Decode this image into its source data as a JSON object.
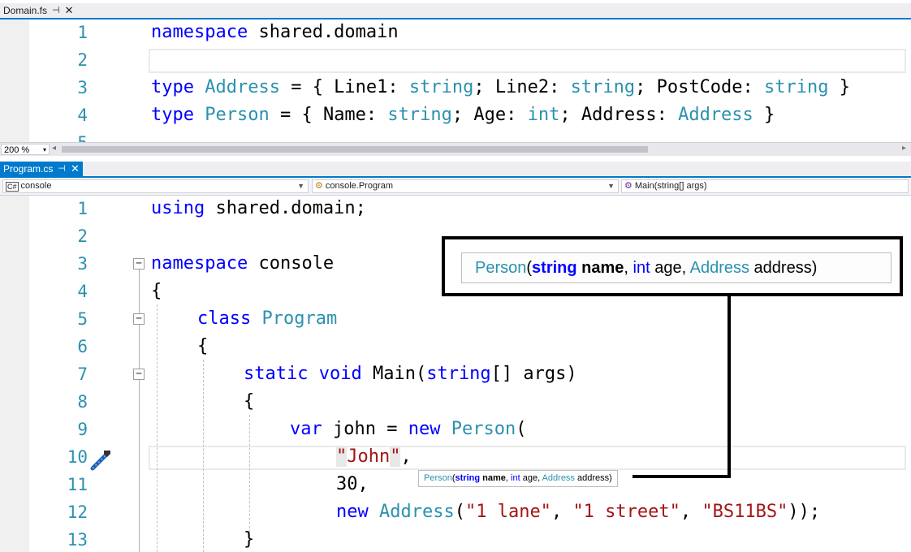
{
  "domain_pane": {
    "tab": {
      "label": "Domain.fs",
      "pin": "⊣",
      "close": "✕"
    },
    "lines": [
      {
        "n": "1",
        "tokens": [
          {
            "t": "namespace",
            "c": "kw"
          },
          {
            "t": " shared.domain",
            "c": ""
          }
        ]
      },
      {
        "n": "2",
        "tokens": []
      },
      {
        "n": "3",
        "tokens": [
          {
            "t": "type",
            "c": "kw"
          },
          {
            "t": " ",
            "c": ""
          },
          {
            "t": "Address",
            "c": "ty"
          },
          {
            "t": " = { Line1: ",
            "c": ""
          },
          {
            "t": "string",
            "c": "ty"
          },
          {
            "t": "; Line2: ",
            "c": ""
          },
          {
            "t": "string",
            "c": "ty"
          },
          {
            "t": "; PostCode: ",
            "c": ""
          },
          {
            "t": "string",
            "c": "ty"
          },
          {
            "t": " }",
            "c": ""
          }
        ]
      },
      {
        "n": "4",
        "tokens": [
          {
            "t": "type",
            "c": "kw"
          },
          {
            "t": " ",
            "c": ""
          },
          {
            "t": "Person",
            "c": "ty"
          },
          {
            "t": " = { Name: ",
            "c": ""
          },
          {
            "t": "string",
            "c": "ty"
          },
          {
            "t": "; Age: ",
            "c": ""
          },
          {
            "t": "int",
            "c": "ty"
          },
          {
            "t": "; Address: ",
            "c": ""
          },
          {
            "t": "Address",
            "c": "ty"
          },
          {
            "t": " }",
            "c": ""
          }
        ]
      }
    ],
    "zoom": "200 %"
  },
  "program_pane": {
    "tab": {
      "label": "Program.cs",
      "pin": "⊣",
      "close": "✕"
    },
    "nav": {
      "project": "console",
      "type": "console.Program",
      "member": "Main(string[] args)"
    },
    "lines": [
      {
        "n": "1",
        "indent": 0,
        "tokens": [
          {
            "t": "using",
            "c": "kw"
          },
          {
            "t": " shared.domain;",
            "c": ""
          }
        ]
      },
      {
        "n": "2",
        "indent": 0,
        "tokens": []
      },
      {
        "n": "3",
        "indent": 0,
        "tokens": [
          {
            "t": "namespace",
            "c": "kw"
          },
          {
            "t": " console",
            "c": ""
          }
        ]
      },
      {
        "n": "4",
        "indent": 0,
        "tokens": [
          {
            "t": "{",
            "c": ""
          }
        ]
      },
      {
        "n": "5",
        "indent": 1,
        "tokens": [
          {
            "t": "class",
            "c": "kw"
          },
          {
            "t": " ",
            "c": ""
          },
          {
            "t": "Program",
            "c": "ty"
          }
        ]
      },
      {
        "n": "6",
        "indent": 1,
        "tokens": [
          {
            "t": "{",
            "c": ""
          }
        ]
      },
      {
        "n": "7",
        "indent": 2,
        "tokens": [
          {
            "t": "static",
            "c": "kw"
          },
          {
            "t": " ",
            "c": ""
          },
          {
            "t": "void",
            "c": "kw"
          },
          {
            "t": " Main(",
            "c": ""
          },
          {
            "t": "string",
            "c": "kw"
          },
          {
            "t": "[] args)",
            "c": ""
          }
        ]
      },
      {
        "n": "8",
        "indent": 2,
        "tokens": [
          {
            "t": "{",
            "c": ""
          }
        ]
      },
      {
        "n": "9",
        "indent": 3,
        "tokens": [
          {
            "t": "var",
            "c": "kw"
          },
          {
            "t": " john = ",
            "c": ""
          },
          {
            "t": "new",
            "c": "kw"
          },
          {
            "t": " ",
            "c": ""
          },
          {
            "t": "Person",
            "c": "ty"
          },
          {
            "t": "(",
            "c": ""
          }
        ]
      },
      {
        "n": "10",
        "indent": 4,
        "tokens": [
          {
            "t": "\"",
            "c": "str hl"
          },
          {
            "t": "John",
            "c": "str"
          },
          {
            "t": "\"",
            "c": "str hl"
          },
          {
            "t": ",",
            "c": ""
          }
        ]
      },
      {
        "n": "11",
        "indent": 4,
        "tokens": [
          {
            "t": "30,",
            "c": ""
          }
        ]
      },
      {
        "n": "12",
        "indent": 4,
        "tokens": [
          {
            "t": "new",
            "c": "kw"
          },
          {
            "t": " ",
            "c": ""
          },
          {
            "t": "Address",
            "c": "ty"
          },
          {
            "t": "(",
            "c": ""
          },
          {
            "t": "\"1 lane\"",
            "c": "str"
          },
          {
            "t": ", ",
            "c": ""
          },
          {
            "t": "\"1 street\"",
            "c": "str"
          },
          {
            "t": ", ",
            "c": ""
          },
          {
            "t": "\"BS11BS\"",
            "c": "str"
          },
          {
            "t": "));",
            "c": ""
          }
        ]
      },
      {
        "n": "13",
        "indent": 2,
        "tokens": [
          {
            "t": "}",
            "c": ""
          }
        ]
      }
    ]
  },
  "signature_tooltip": {
    "parts": [
      {
        "t": "Person",
        "c": "ty"
      },
      {
        "t": "(",
        "c": ""
      },
      {
        "t": "string",
        "c": "kw bold"
      },
      {
        "t": " ",
        "c": ""
      },
      {
        "t": "name",
        "c": "bold"
      },
      {
        "t": ", ",
        "c": ""
      },
      {
        "t": "int",
        "c": "kw"
      },
      {
        "t": " age, ",
        "c": ""
      },
      {
        "t": "Address",
        "c": "ty"
      },
      {
        "t": " address)",
        "c": ""
      }
    ]
  },
  "colors": {
    "keyword": "#0000ff",
    "type": "#2b91af",
    "string": "#a31515",
    "line_number": "#2b91af",
    "accent": "#007acc"
  }
}
